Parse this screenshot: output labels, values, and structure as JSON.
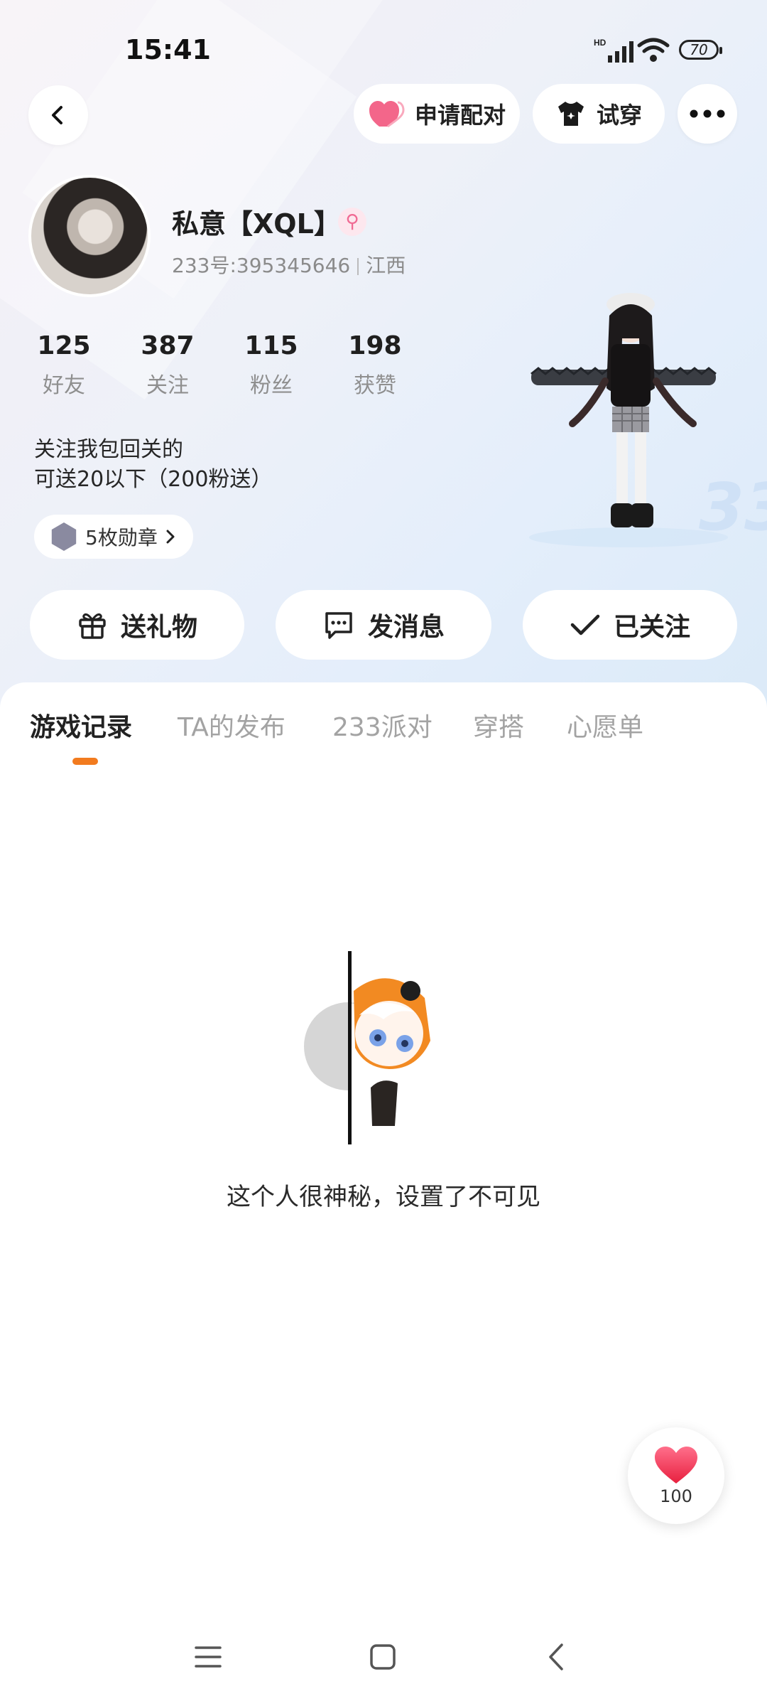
{
  "status_bar": {
    "time": "15:41",
    "network": "HD",
    "battery": "70"
  },
  "top_nav": {
    "pair_label": "申请配对",
    "tryon_label": "试穿"
  },
  "profile": {
    "name": "私意【XQL】",
    "gender_symbol": "⚲",
    "uid": "233号:395345646",
    "region": "江西",
    "stats": [
      {
        "value": "125",
        "label": "好友"
      },
      {
        "value": "387",
        "label": "关注"
      },
      {
        "value": "115",
        "label": "粉丝"
      },
      {
        "value": "198",
        "label": "获赞"
      }
    ],
    "bio_line1": "关注我包回关的",
    "bio_line2": "可送20以下（200粉送）",
    "badges_label": "5枚勋章"
  },
  "actions": {
    "gift_label": "送礼物",
    "message_label": "发消息",
    "follow_label": "已关注"
  },
  "tabs": [
    {
      "label": "游戏记录",
      "active": true
    },
    {
      "label": "TA的发布",
      "active": false
    },
    {
      "label": "233派对",
      "active": false
    },
    {
      "label": "穿搭",
      "active": false
    },
    {
      "label": "心愿单",
      "active": false
    }
  ],
  "empty_state": {
    "message": "这个人很神秘，设置了不可见"
  },
  "like_fab": {
    "count": "100"
  },
  "colors": {
    "accent": "#f27b1f",
    "heart": "#f0436c"
  }
}
